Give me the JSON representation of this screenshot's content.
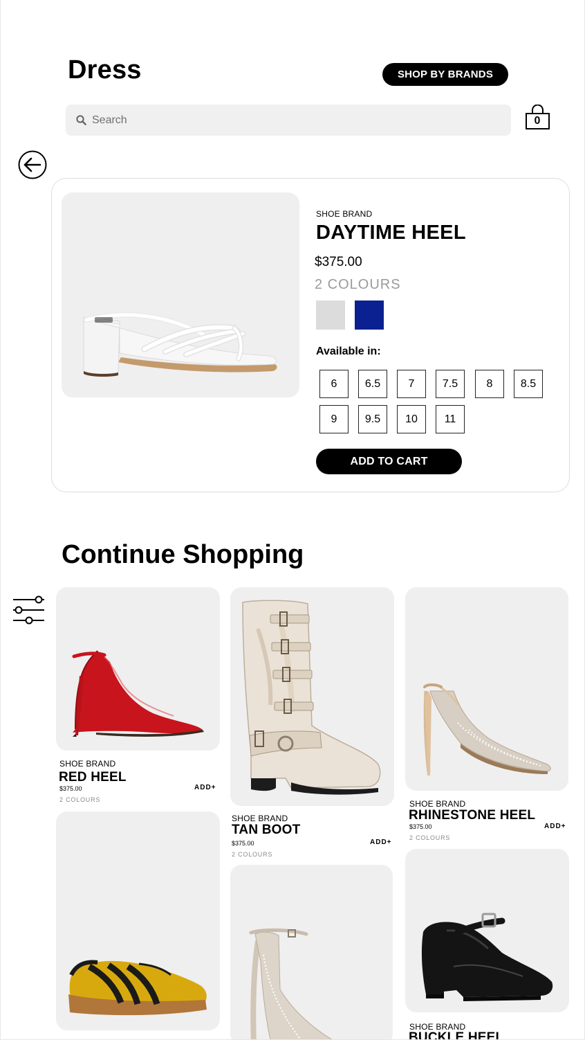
{
  "header": {
    "title": "Dress",
    "shop_by_brands_label": "SHOP BY BRANDS",
    "search_placeholder": "Search",
    "cart_count": "0"
  },
  "product": {
    "brand": "SHOE BRAND",
    "name": "DAYTIME HEEL",
    "price": "$375.00",
    "colours": "2 COLOURS",
    "swatches": [
      {
        "name": "light-grey",
        "color": "#dcdcdc"
      },
      {
        "name": "royal-blue",
        "color": "#0b2191"
      }
    ],
    "available_label": "Available in:",
    "sizes": [
      "6",
      "6.5",
      "7",
      "7.5",
      "8",
      "8.5",
      "9",
      "9.5",
      "10",
      "11"
    ],
    "add_to_cart_label": "ADD TO CART"
  },
  "continue": {
    "title": "Continue Shopping",
    "add_label": "ADD+",
    "items": [
      {
        "brand": "SHOE BRAND",
        "name": "RED HEEL",
        "price": "$375.00",
        "colours": "2 COLOURS"
      },
      {
        "brand": "SHOE BRAND",
        "name": "TAN BOOT",
        "price": "$375.00",
        "colours": "2 COLOURS"
      },
      {
        "brand": "SHOE BRAND",
        "name": "RHINESTONE HEEL",
        "price": "$375.00",
        "colours": "2 COLOURS"
      },
      {
        "brand": "SHOE BRAND",
        "name": "BUCKLE HEEL"
      }
    ]
  },
  "icons": [
    "search-icon",
    "shopping-bag-icon",
    "back-arrow-icon",
    "filter-sliders-icon"
  ]
}
